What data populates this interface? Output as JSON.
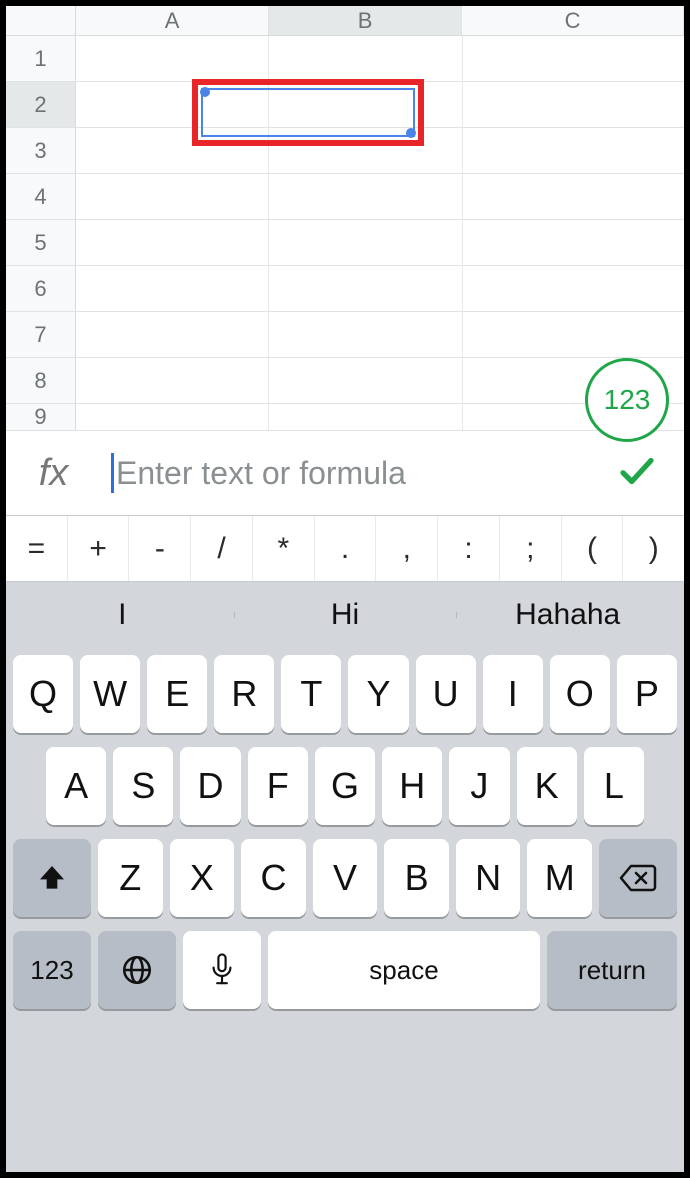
{
  "sheet": {
    "columns": [
      "A",
      "B",
      "C"
    ],
    "rows": [
      "1",
      "2",
      "3",
      "4",
      "5",
      "6",
      "7",
      "8",
      "9"
    ],
    "selected_cell": "B2"
  },
  "fab": {
    "label": "123"
  },
  "formula_bar": {
    "fx_label": "fx",
    "placeholder": "Enter text or formula",
    "value": ""
  },
  "symbol_row": [
    "=",
    "+",
    "-",
    "/",
    "*",
    ".",
    ",",
    ":",
    ";",
    "(",
    ")"
  ],
  "keyboard": {
    "suggestions": [
      "I",
      "Hi",
      "Hahaha"
    ],
    "row1": [
      "Q",
      "W",
      "E",
      "R",
      "T",
      "Y",
      "U",
      "I",
      "O",
      "P"
    ],
    "row2": [
      "A",
      "S",
      "D",
      "F",
      "G",
      "H",
      "J",
      "K",
      "L"
    ],
    "row3": [
      "Z",
      "X",
      "C",
      "V",
      "B",
      "N",
      "M"
    ],
    "numeric_label": "123",
    "space_label": "space",
    "return_label": "return"
  }
}
